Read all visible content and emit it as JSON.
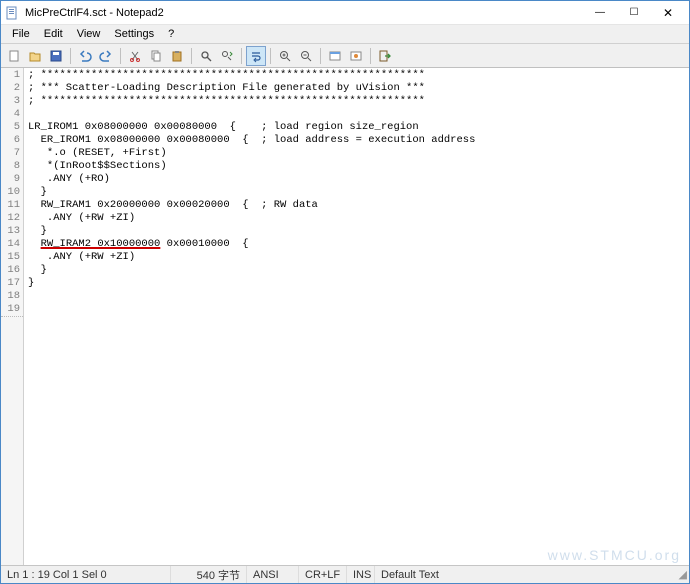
{
  "window": {
    "title": "MicPreCtrlF4.sct - Notepad2",
    "min": "—",
    "max": "☐",
    "close": "✕"
  },
  "menu": {
    "file": "File",
    "edit": "Edit",
    "view": "View",
    "settings": "Settings",
    "help": "?"
  },
  "toolbar_icons": {
    "new": "new-icon",
    "open": "open-icon",
    "save": "save-icon",
    "undo": "undo-icon",
    "redo": "redo-icon",
    "cut": "cut-icon",
    "copy": "copy-icon",
    "paste": "paste-icon",
    "find": "find-icon",
    "replace": "replace-icon",
    "wordwrap": "wordwrap-icon",
    "zoomin": "zoomin-icon",
    "zoomout": "zoomout-icon",
    "scheme": "scheme-icon",
    "custom": "custom-icon",
    "exit": "exit-icon"
  },
  "lines": [
    "; *************************************************************",
    "; *** Scatter-Loading Description File generated by uVision ***",
    "; *************************************************************",
    "",
    "LR_IROM1 0x08000000 0x00080000  {    ; load region size_region",
    "  ER_IROM1 0x08000000 0x00080000  {  ; load address = execution address",
    "   *.o (RESET, +First)",
    "   *(InRoot$$Sections)",
    "   .ANY (+RO)",
    "  }",
    "  RW_IRAM1 0x20000000 0x00020000  {  ; RW data",
    "   .ANY (+RW +ZI)",
    "  }",
    "  RW_IRAM2 0x10000000 0x00010000  {",
    "   .ANY (+RW +ZI)",
    "  }",
    "}",
    "",
    ""
  ],
  "highlight_line_index": 13,
  "highlight_text": "RW_IRAM2 0x10000000",
  "status": {
    "pos": "Ln 1 : 19   Col 1   Sel 0",
    "size": "540 字节",
    "enc": "ANSI",
    "eol": "CR+LF",
    "ins": "INS",
    "ftype": "Default Text"
  },
  "watermark": "www.STMCU.org"
}
